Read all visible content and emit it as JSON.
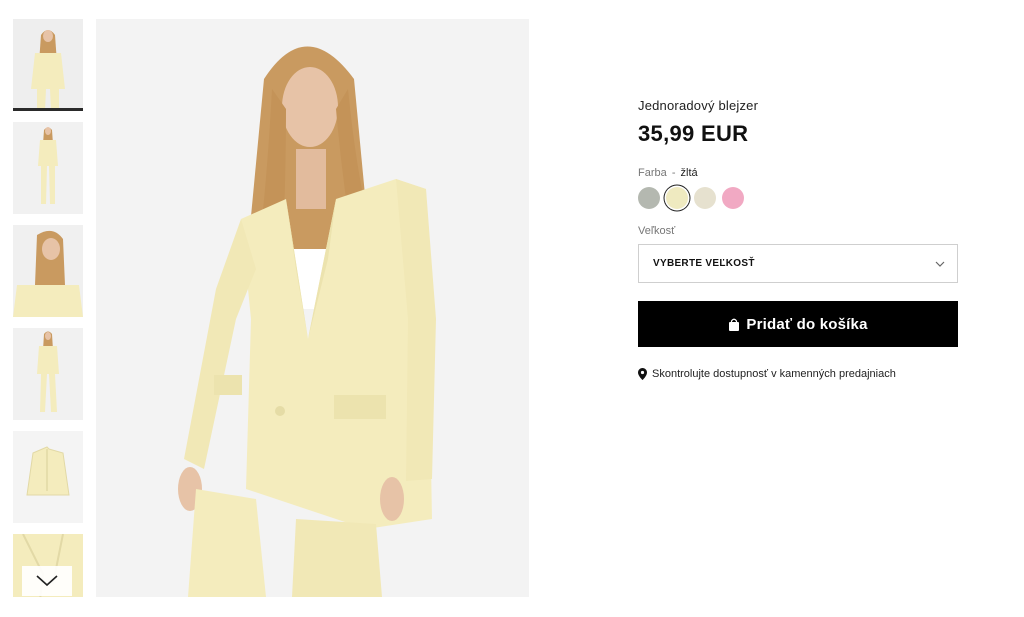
{
  "product": {
    "name": "Jednoradový blejzer",
    "price": "35,99 EUR"
  },
  "color": {
    "label": "Farba",
    "separator": "-",
    "selected": "žltá",
    "swatches": [
      {
        "name": "gray-green",
        "hex": "#b4b8b0"
      },
      {
        "name": "yellow",
        "hex": "#efeac0",
        "selected": true
      },
      {
        "name": "beige",
        "hex": "#e6e1cf"
      },
      {
        "name": "pink",
        "hex": "#f1a9c3"
      }
    ]
  },
  "size": {
    "label": "Veľkosť",
    "placeholder": "VYBERTE VEĽKOSŤ"
  },
  "cart": {
    "button_label": "Pridať do košíka"
  },
  "store_availability": {
    "label": "Skontrolujte dostupnosť v kamenných predajniach"
  },
  "thumbnails": [
    {
      "name": "thumb-1",
      "active": true
    },
    {
      "name": "thumb-2"
    },
    {
      "name": "thumb-3"
    },
    {
      "name": "thumb-4"
    },
    {
      "name": "thumb-5"
    },
    {
      "name": "thumb-6"
    }
  ],
  "colors": {
    "blazer": "#f4ecbd",
    "hair": "#c99a60",
    "skin": "#e7c3a7",
    "background": "#f3f3f3",
    "button": "#000000"
  },
  "icons": {
    "scroll_down": "chevron-down-icon",
    "bag": "shopping-bag-icon",
    "location": "location-pin-icon",
    "select": "chevron-down-icon"
  }
}
